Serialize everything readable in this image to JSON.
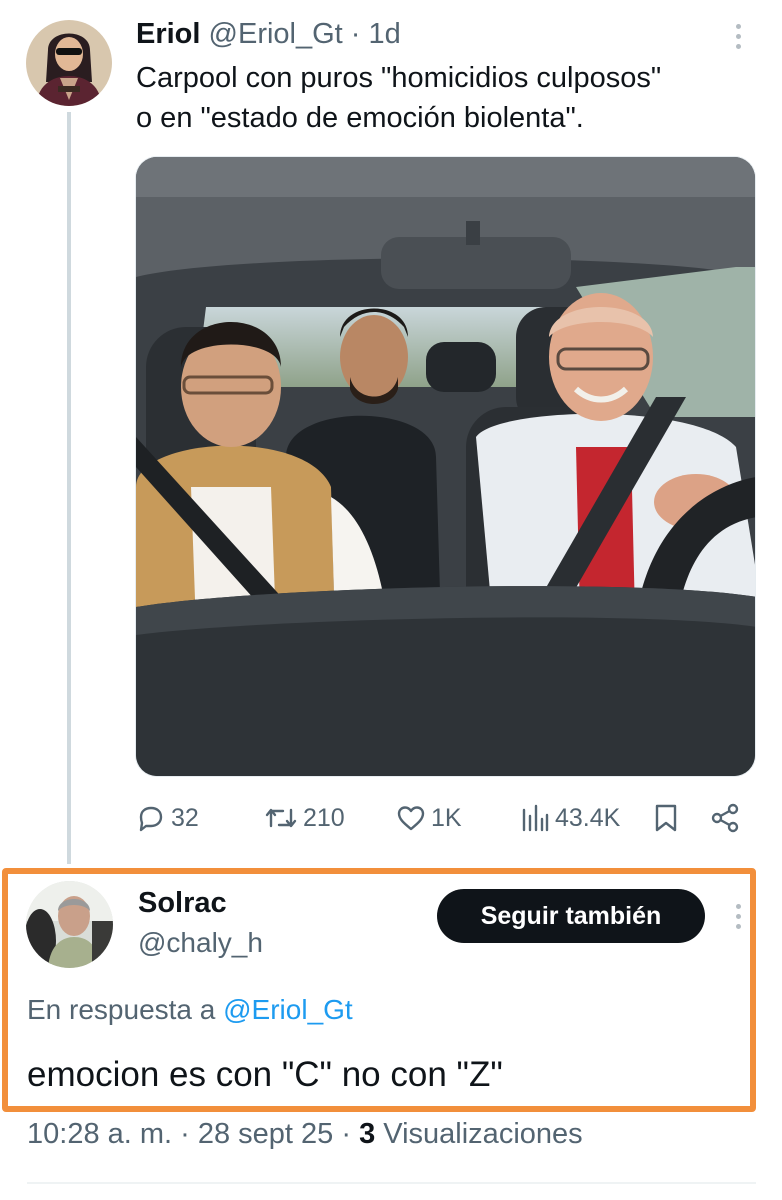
{
  "tweet": {
    "author_name": "Eriol",
    "handle": "@Eriol_Gt",
    "separator": "·",
    "age": "1d",
    "text": "Carpool con puros \"homicidios culposos\"\no en \"estado de emoción biolenta\".",
    "avatar_icon": "user-avatar",
    "media_icon": "photo-car-passengers",
    "actions": {
      "replies": "32",
      "retweets": "210",
      "likes": "1K",
      "views": "43.4K"
    }
  },
  "reply": {
    "author_name": "Solrac",
    "handle": "@chaly_h",
    "follow_label": "Seguir también",
    "reply_prefix": "En respuesta a",
    "reply_mention": "@Eriol_Gt",
    "text": "emocion es con \"C\" no con \"Z\"",
    "time": "10:28 a. m. · 28 sept 25 ·",
    "views_count": "3",
    "views_label": "Visualizaciones"
  },
  "colors": {
    "text_primary": "#0f1419",
    "text_secondary": "#536471",
    "link": "#1d9bf0",
    "highlight_border": "#f28f3b",
    "follow_button": "#0f1419"
  }
}
